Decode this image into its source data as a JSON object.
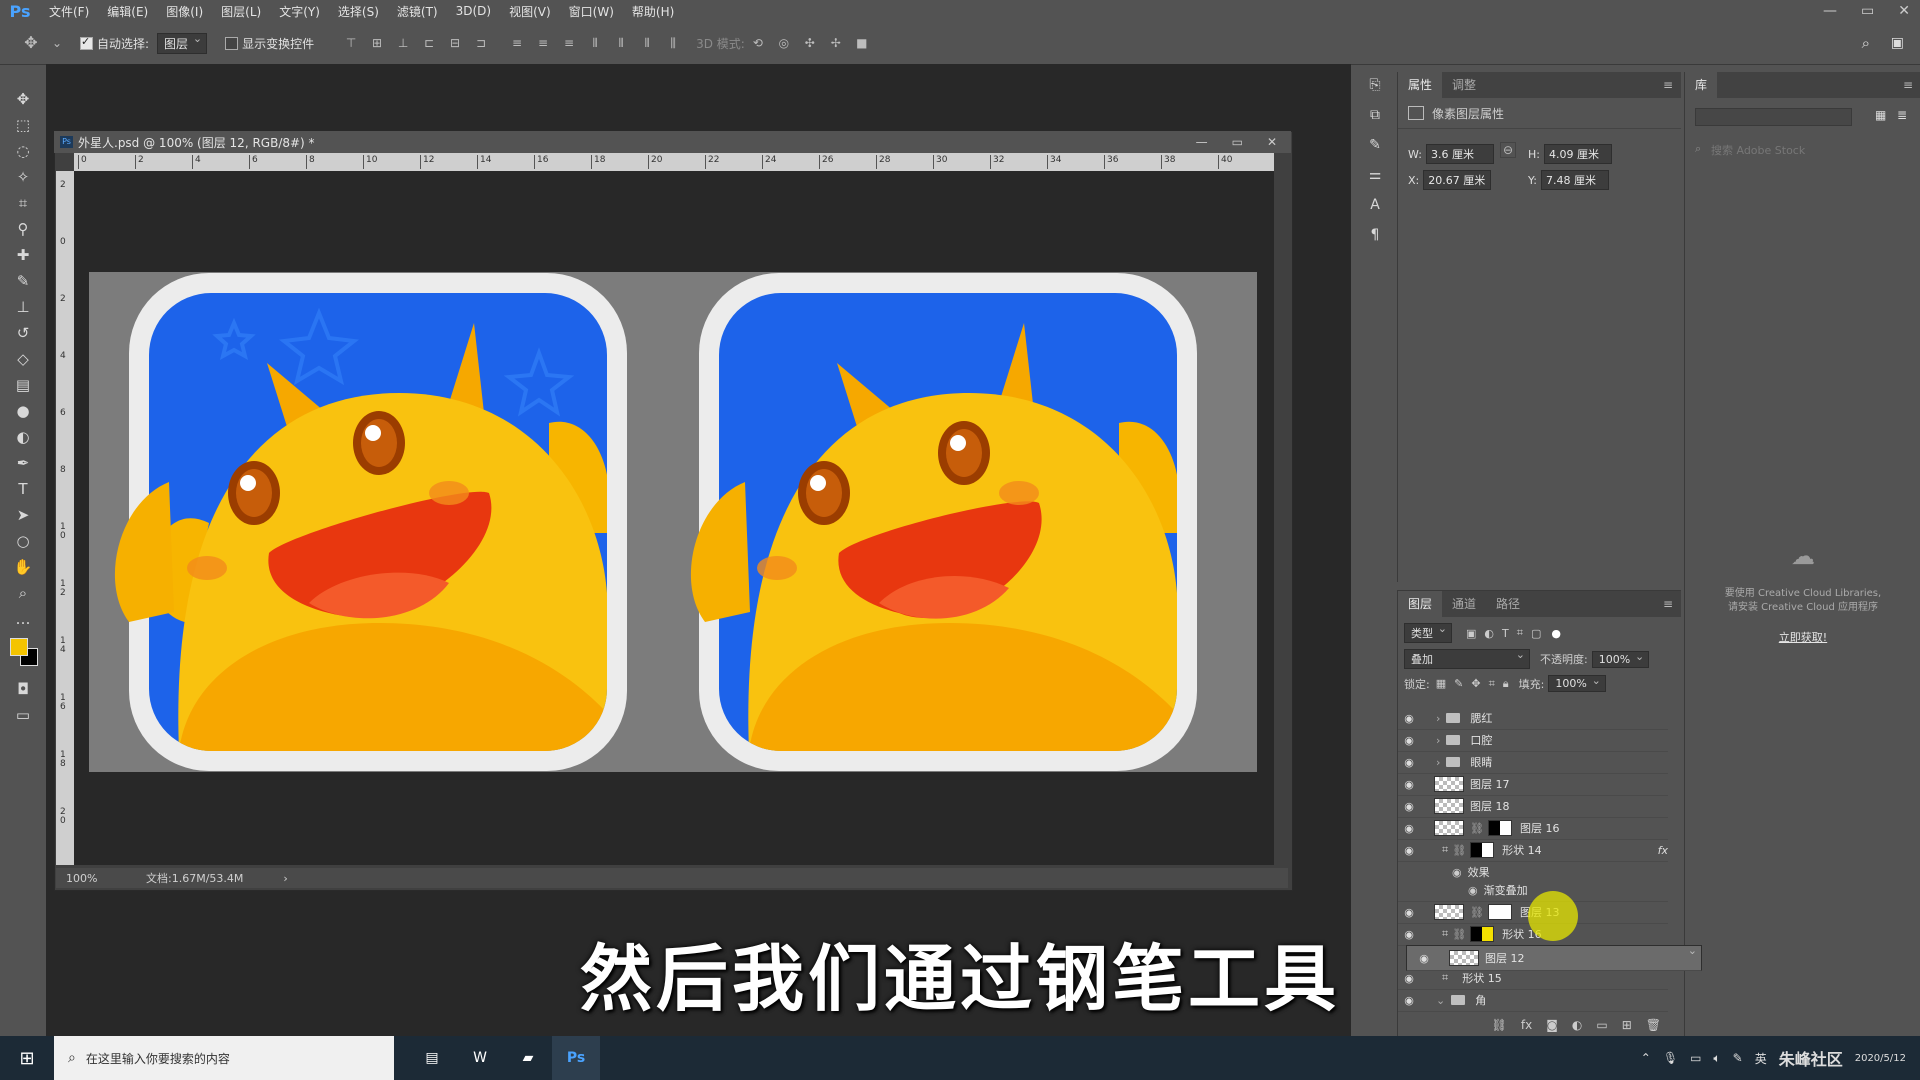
{
  "menubar": {
    "logo": "Ps",
    "items": [
      "文件(F)",
      "编辑(E)",
      "图像(I)",
      "图层(L)",
      "文字(Y)",
      "选择(S)",
      "滤镜(T)",
      "3D(D)",
      "视图(V)",
      "窗口(W)",
      "帮助(H)"
    ],
    "win_min": "—",
    "win_max": "▭",
    "win_close": "✕"
  },
  "options": {
    "auto_select_label": "自动选择:",
    "auto_select_value": "图层",
    "show_transform_label": "显示变换控件",
    "mode_3d_label": "3D 模式:"
  },
  "document": {
    "tab_title": "外星人.psd @ 100% (图层 12, RGB/8#) *",
    "ruler_h": [
      "0",
      "2",
      "4",
      "6",
      "8",
      "10",
      "12",
      "14",
      "16",
      "18",
      "20",
      "22",
      "24",
      "26",
      "28",
      "30",
      "32",
      "34",
      "36",
      "38",
      "40"
    ],
    "ruler_v": [
      "2",
      "0",
      "2",
      "4",
      "6",
      "8",
      "1\n0",
      "1\n2",
      "1\n4",
      "1\n6",
      "1\n8",
      "2\n0"
    ],
    "zoom": "100%",
    "doc_size": "文档:1.67M/53.4M"
  },
  "properties": {
    "tab_active": "属性",
    "tab_other": "调整",
    "section_title": "像素图层属性",
    "w_label": "W:",
    "w_value": "3.6 厘米",
    "h_label": "H:",
    "h_value": "4.09 厘米",
    "x_label": "X:",
    "x_value": "20.67 厘米",
    "y_label": "Y:",
    "y_value": "7.48 厘米"
  },
  "library": {
    "tab": "库",
    "search_placeholder": "搜索 Adobe Stock",
    "message_line1": "要使用 Creative Cloud Libraries,",
    "message_line2": "请安装 Creative Cloud 应用程序",
    "link": "立即获取!"
  },
  "layers": {
    "tabs": [
      "图层",
      "通道",
      "路径"
    ],
    "filter_kind": "类型",
    "blend_mode": "叠加",
    "opacity_label": "不透明度:",
    "opacity_value": "100%",
    "lock_label": "锁定:",
    "fill_label": "填充:",
    "fill_value": "100%",
    "rows": [
      {
        "name": "腮红"
      },
      {
        "name": "口腔"
      },
      {
        "name": "眼睛"
      },
      {
        "name": "图层 17"
      },
      {
        "name": "图层 18"
      },
      {
        "name": "图层 16"
      },
      {
        "name": "形状 14",
        "fx": "fx"
      },
      {
        "name": "效果"
      },
      {
        "name": "渐变叠加"
      },
      {
        "name": "图层 13"
      },
      {
        "name": "形状 16"
      },
      {
        "name": "图层 12"
      },
      {
        "name": "形状 15"
      },
      {
        "name": "角"
      }
    ]
  },
  "caption": "然后我们通过钢笔工具",
  "taskbar": {
    "search_placeholder": "在这里输入你要搜索的内容",
    "ime": "英",
    "watermark": "朱峰社区",
    "date": "2020/5/12"
  },
  "colors": {
    "accent_blue": "#1d63ea",
    "foreground_swatch": "#f4c400",
    "background_swatch": "#000000"
  }
}
